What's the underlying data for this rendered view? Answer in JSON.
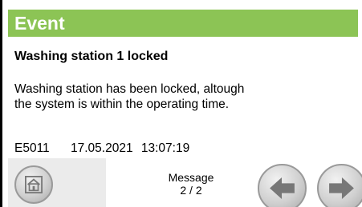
{
  "title": "Event",
  "heading": "Washing station 1 locked",
  "body_lines": [
    "Washing station has been locked, altough",
    "the system is within the operating time."
  ],
  "event": {
    "code": "E5011",
    "date": "17.05.2021",
    "time": "13:07:19"
  },
  "footer": {
    "message_label": "Message",
    "message_counter": "2 / 2"
  },
  "icons": {
    "home": "home-icon",
    "previous": "arrow-left-icon",
    "next": "arrow-right-icon"
  },
  "colors": {
    "title_bar": "#8cc455",
    "title_text": "#ffffff",
    "home_tile": "#ebebeb",
    "button_face": "#d0d0d0",
    "icon_fill": "#777777"
  }
}
